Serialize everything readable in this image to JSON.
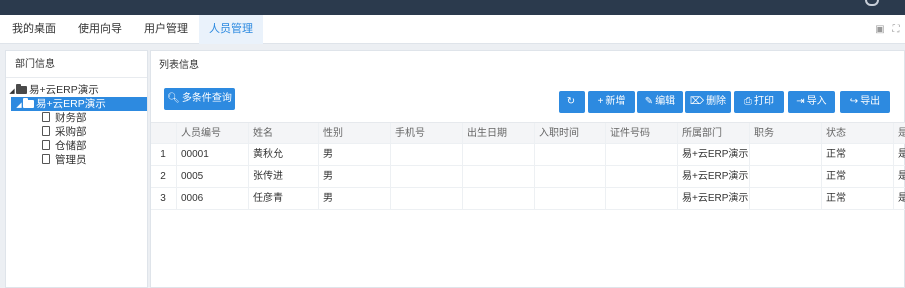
{
  "tabs": [
    {
      "label": "我的桌面"
    },
    {
      "label": "使用向导"
    },
    {
      "label": "用户管理"
    },
    {
      "label": "人员管理"
    }
  ],
  "tab_tools": {
    "restore_glyph": "▣",
    "fullscreen_glyph": "⛶"
  },
  "left_panel": {
    "title": "部门信息",
    "tree": {
      "root": "易+云ERP演示",
      "child": "易+云ERP演示",
      "items": [
        "财务部",
        "采购部",
        "仓储部",
        "管理员"
      ]
    }
  },
  "right_panel": {
    "title": "列表信息",
    "search_label": "多条件查询",
    "toolbar": {
      "refresh_label": "",
      "add_label": "新增",
      "edit_label": "编辑",
      "delete_label": "删除",
      "print_label": "打印",
      "import_label": "导入",
      "export_label": "导出"
    }
  },
  "table": {
    "columns": [
      "人员编号",
      "姓名",
      "性别",
      "手机号",
      "出生日期",
      "入职时间",
      "证件号码",
      "所属部门",
      "职务",
      "状态",
      "是"
    ],
    "rows": [
      {
        "num": "1",
        "cells": [
          "00001",
          "黄秋允",
          "男",
          "",
          "",
          "",
          "",
          "易+云ERP演示",
          "",
          "正常",
          "是"
        ]
      },
      {
        "num": "2",
        "cells": [
          "0005",
          "张传进",
          "男",
          "",
          "",
          "",
          "",
          "易+云ERP演示",
          "",
          "正常",
          "是"
        ]
      },
      {
        "num": "3",
        "cells": [
          "0006",
          "任彦青",
          "男",
          "",
          "",
          "",
          "",
          "易+云ERP演示",
          "",
          "正常",
          "是"
        ]
      }
    ]
  },
  "colors": {
    "accent": "#2d8ae0",
    "topbar": "#2b3a4d"
  }
}
